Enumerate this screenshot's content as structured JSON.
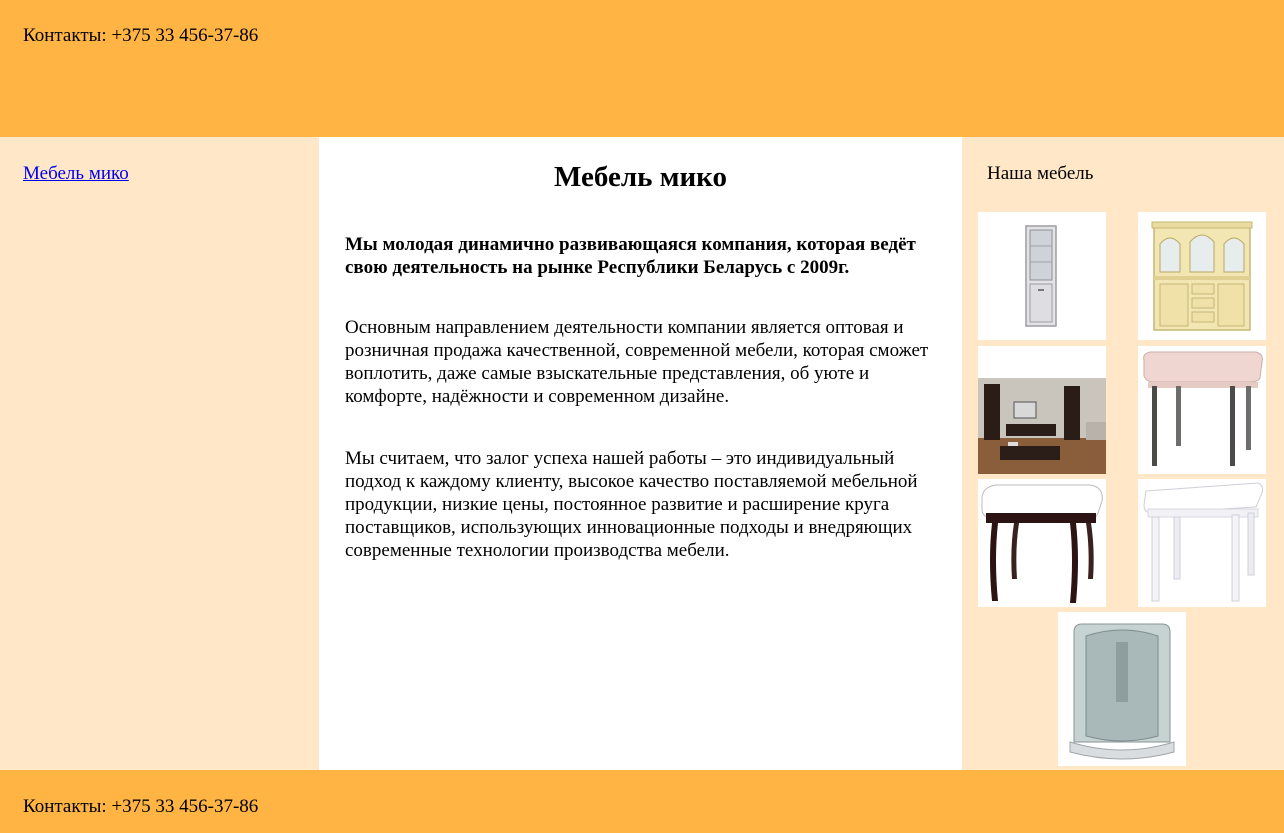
{
  "header": {
    "contacts": "Контакты: +375 33 456-37-86"
  },
  "sidebar": {
    "link": "Мебель мико"
  },
  "main": {
    "title": "Мебель мико",
    "lead": "Мы молодая динамично развивающаяся компания, которая ведёт свою деятельность на рынке Республики Беларусь с 2009г.",
    "paragraph1": "Основным направлением деятельности компании является оптовая и розничная продажа качественной, современной мебели, которая сможет воплотить, даже самые взыскательные представления, об уюте и комфорте, надёжности и современном дизайне.",
    "paragraph2": "Мы считаем, что залог успеха нашей работы – это индивидуальный подход к каждому клиенту, высокое качество поставляемой мебельной продукции, низкие цены, постоянное развитие и расширение круга поставщиков, использующих инновационные подходы и внедряющих современные технологии производства мебели."
  },
  "gallery": {
    "title": "Наша мебель",
    "images": [
      "narrow-cabinet-image",
      "cream-cupboard-image",
      "living-room-image",
      "pink-table-image",
      "dark-table-image",
      "white-table-image",
      "shower-cabin-image"
    ]
  },
  "footer": {
    "contacts": "Контакты: +375 33 456-37-86"
  },
  "colors": {
    "header_bg": "#ffb443",
    "sidebar_bg": "#ffe7c8",
    "main_bg": "#ffffff",
    "link": "#0000ee"
  }
}
